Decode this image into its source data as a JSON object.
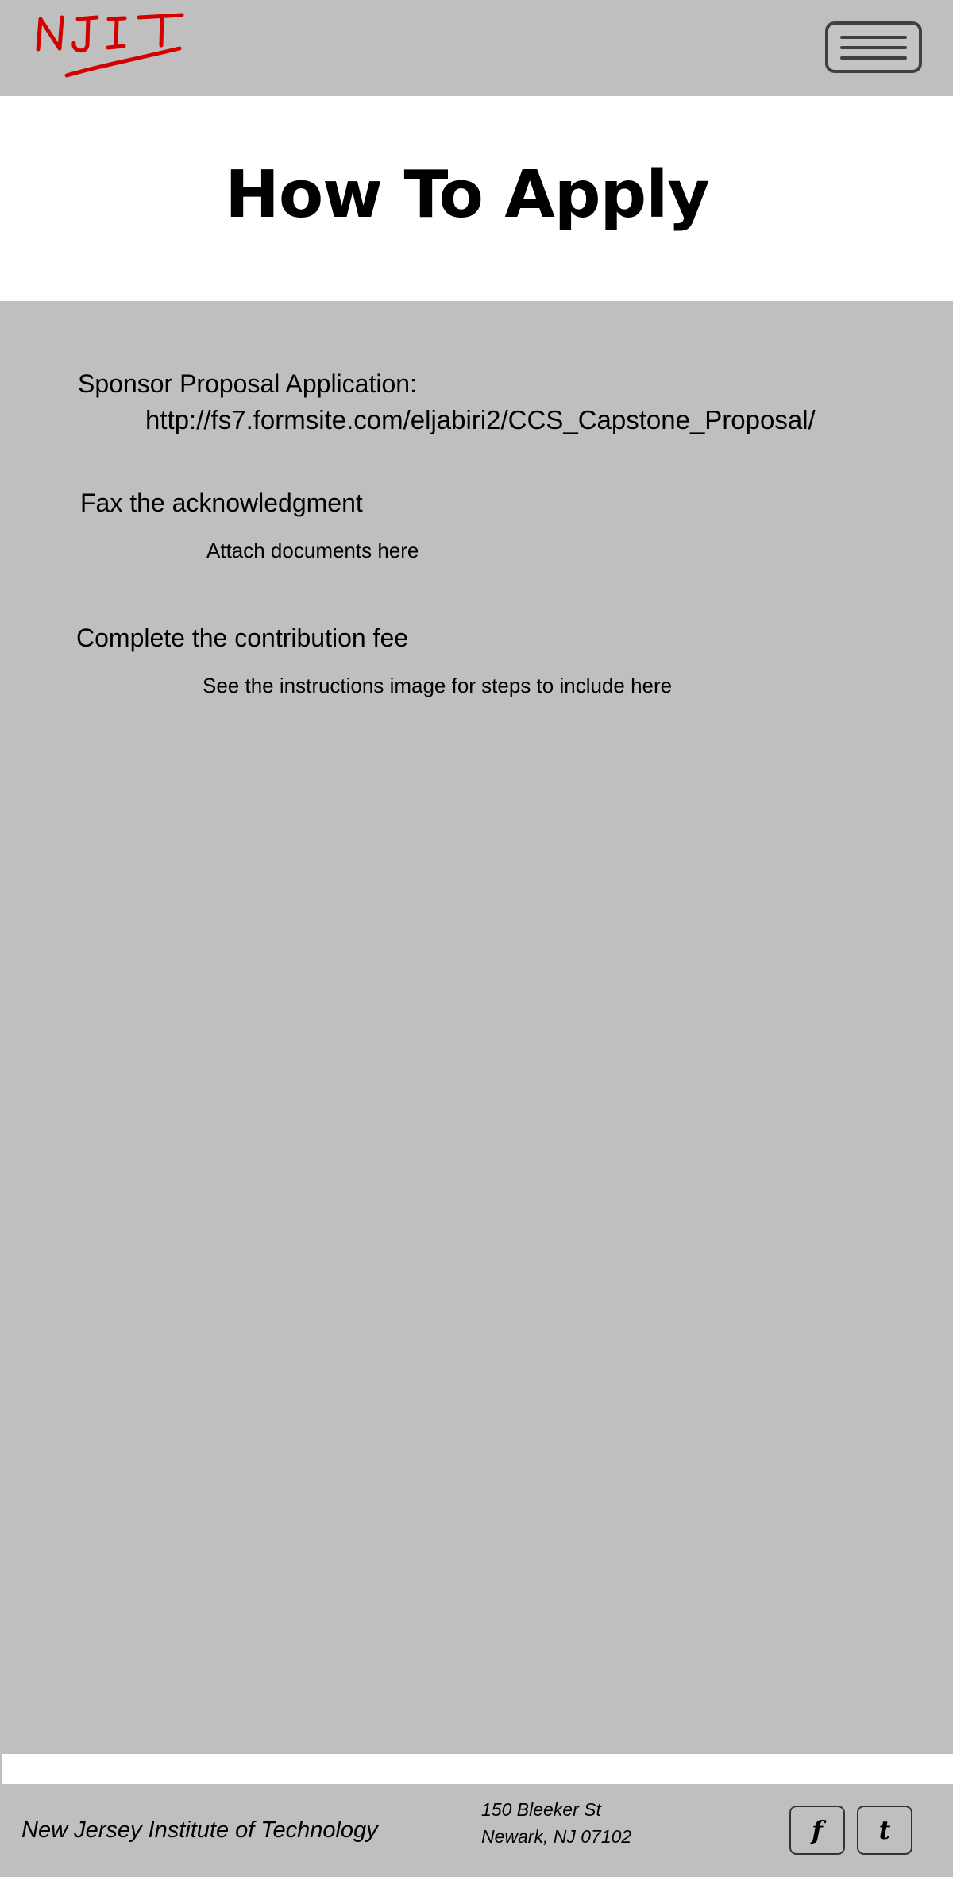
{
  "header": {
    "logo_text": "NJIT",
    "logo_color": "#d40000"
  },
  "page": {
    "title": "How To Apply"
  },
  "sections": {
    "sponsor": {
      "heading": "Sponsor Proposal Application:",
      "link": "http://fs7.formsite.com/eljabiri2/CCS_Capstone_Proposal/"
    },
    "fax": {
      "heading": "Fax the acknowledgment",
      "note": "Attach documents here"
    },
    "fee": {
      "heading": "Complete the contribution fee",
      "note": "See the instructions image for steps to include here"
    }
  },
  "footer": {
    "org_name": "New Jersey Institute of Technology",
    "address_line1": "150 Bleeker St",
    "address_line2": "Newark, NJ 07102",
    "facebook_label": "f",
    "twitter_label": "t"
  },
  "colors": {
    "background": "#bfbfbf",
    "panel": "#ffffff",
    "menu_border": "#404040"
  },
  "icons": {
    "menu": "hamburger-menu-icon",
    "facebook": "facebook-icon",
    "twitter": "twitter-icon"
  }
}
